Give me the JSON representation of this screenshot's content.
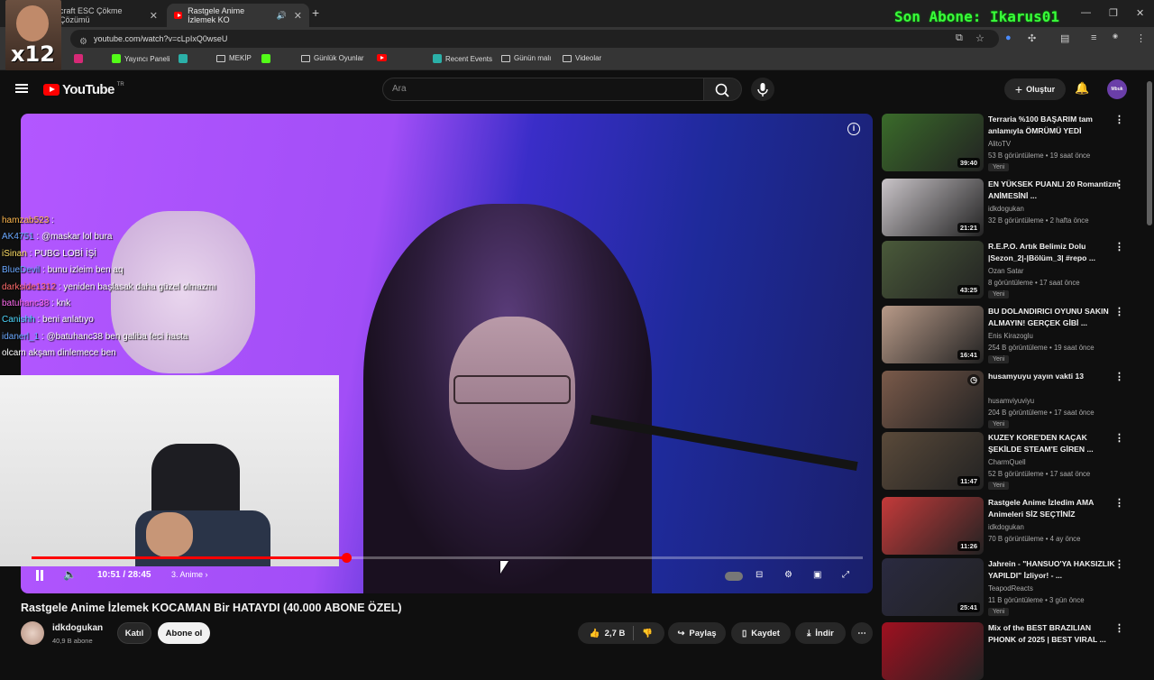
{
  "browser": {
    "tabs": [
      {
        "label": "craft ESC Çökme Çözümü",
        "active": false
      },
      {
        "label": "Rastgele Anime İzlemek KO",
        "active": true
      }
    ],
    "new_tab": "+",
    "url": "youtube.com/watch?v=cLpIxQ0wseU",
    "overlay_text": "Son Abone: Ikarus01",
    "cam_badge_text": "x12",
    "bookmarks": [
      "Yayıncı Paneli",
      "MEKİP",
      "Günlük Oyunlar",
      "Recent Events",
      "Günün malı",
      "Videolar"
    ]
  },
  "youtube": {
    "logo_text": "YouTube",
    "logo_region": "TR",
    "search_placeholder": "Ara",
    "create_label": "Oluştur",
    "user_avatar_text": "Mbuk"
  },
  "player": {
    "time_current": "10:51",
    "time_total": "28:45",
    "chapter": "3. Anime",
    "progress_fraction": 0.378,
    "chat": [
      {
        "user": "hamzab523",
        "msg": ""
      },
      {
        "user": "AK4751",
        "msg": "@maskar lol bura"
      },
      {
        "user": "iSinan",
        "msg": "PUBG LOBİ İŞİ"
      },
      {
        "user": "BlueDevil",
        "msg": "bunu izleim ben aq"
      },
      {
        "user": "darkside1312",
        "msg": "yeniden başlasak daha güzel olmazmı"
      },
      {
        "user": "batuhanc38",
        "msg": "knk"
      },
      {
        "user": "Canishh",
        "msg": "beni anlatıyo"
      },
      {
        "user": "idanerl_1",
        "msg": "@batuhanc38 ben galiba feci hasta"
      },
      {
        "user": "",
        "msg": "olcam akşam dinlemece ben"
      }
    ]
  },
  "video": {
    "title": "Rastgele Anime İzlemek KOCAMAN Bir HATAYDI (40.000 ABONE ÖZEL)",
    "channel": "idkdogukan",
    "subscribers": "40,9 B abone",
    "join_label": "Katıl",
    "subscribe_label": "Abone ol",
    "likes": "2,7 B",
    "share_label": "Paylaş",
    "save_label": "Kaydet",
    "download_label": "İndir"
  },
  "sidebar": [
    {
      "title": "Terraria %100 BAŞARIM tam anlamıyla ÖMRÜMÜ YEDİ",
      "channel": "AlitoTV",
      "meta": "53 B görüntüleme • 19 saat önce",
      "duration": "39:40",
      "badge": "Yeni",
      "thumb": "#3a6b2a"
    },
    {
      "title": "EN YÜKSEK PUANLI 20 Romantizm ANİMESİNİ ...",
      "channel": "idkdogukan",
      "meta": "32 B görüntüleme • 2 hafta önce",
      "duration": "21:21",
      "badge": "",
      "thumb": "#c9c4c8"
    },
    {
      "title": "R.E.P.O. Artık Belimiz Dolu |Sezon_2|-|Bölüm_3| #repo ...",
      "channel": "Ozan Satar",
      "meta": "8 görüntüleme • 17 saat önce",
      "duration": "43:25",
      "badge": "Yeni",
      "thumb": "#4a5a3a"
    },
    {
      "title": "BU DOLANDIRICI OYUNU SAKIN ALMAYIN! GERÇEK GİBİ ...",
      "channel": "Enis Kirazoglu",
      "meta": "254 B görüntüleme • 19 saat önce",
      "duration": "16:41",
      "badge": "Yeni",
      "thumb": "#b89a88"
    },
    {
      "title": "husamyuyu yayın vakti 13",
      "channel": "husamviyuviyu",
      "meta": "204 B görüntüleme • 17 saat önce",
      "duration": "",
      "badge": "Yeni",
      "thumb": "#7a5a4a"
    },
    {
      "title": "KUZEY KORE'DEN KAÇAK ŞEKİLDE STEAM'E GİREN ...",
      "channel": "CharmQuell",
      "meta": "52 B görüntüleme • 17 saat önce",
      "duration": "11:47",
      "badge": "Yeni",
      "thumb": "#5a4a3a"
    },
    {
      "title": "Rastgele Anime İzledim AMA Animeleri SİZ SEÇTİNİZ",
      "channel": "idkdogukan",
      "meta": "70 B görüntüleme • 4 ay önce",
      "duration": "11:26",
      "badge": "",
      "thumb": "#c43a3a"
    },
    {
      "title": "Jahrein - \"HANSUO'YA HAKSIZLIK YAPILDI\" İzliyor! - ...",
      "channel": "TeapodReacts",
      "meta": "11 B görüntüleme • 3 gün önce",
      "duration": "25:41",
      "badge": "Yeni",
      "thumb": "#2a2a40"
    },
    {
      "title": "Mix of the BEST BRAZILIAN PHONK of 2025 | BEST VIRAL ...",
      "channel": "",
      "meta": "",
      "duration": "",
      "badge": "",
      "thumb": "#a01020"
    }
  ]
}
